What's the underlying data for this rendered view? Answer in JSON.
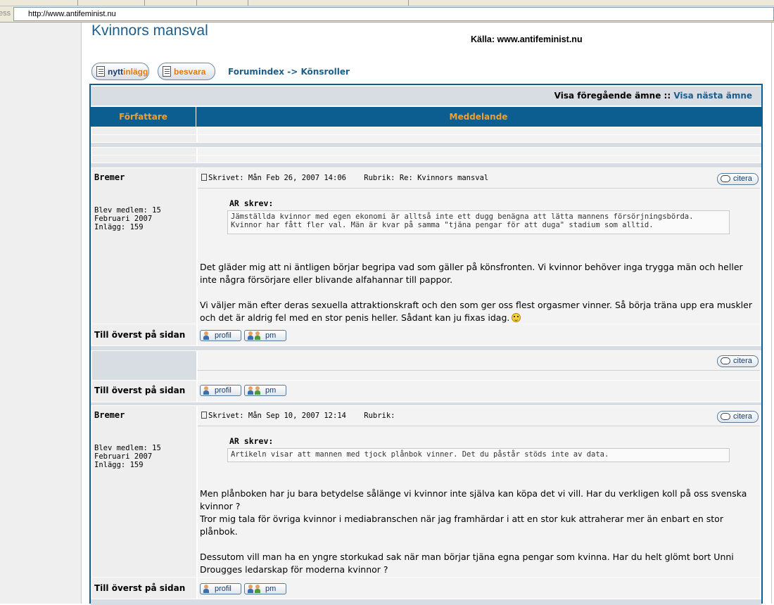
{
  "browser": {
    "address_label": "ess",
    "url": "http://www.antifeminist.nu"
  },
  "page": {
    "title": "Kvinnors mansval",
    "source": "Källa: www.antifeminist.nu"
  },
  "toolbar": {
    "new_post_a": "nytt",
    "new_post_b": "inlägg",
    "reply": "besvara"
  },
  "breadcrumb": {
    "index": "Forumindex",
    "sep": " -> ",
    "category": "Könsroller"
  },
  "nav": {
    "prev": "Visa föregående ämne",
    "sep": " :: ",
    "next": "Visa nästa ämne"
  },
  "table": {
    "col_author": "Författare",
    "col_message": "Meddelande"
  },
  "labels": {
    "cite": "citera",
    "to_top": "Till överst på sidan",
    "profile": "profil",
    "pm": "pm"
  },
  "posts": [
    {
      "author": "Bremer",
      "member_since": "Blev medlem: 15",
      "member_month": "Februari 2007",
      "post_count": "Inlägg: 159",
      "header": "Skrivet: Mån Feb 26, 2007 14:06    Rubrik: Re: Kvinnors mansval",
      "quote_who": "AR skrev:",
      "quote": "Jämställda kvinnor med egen ekonomi är alltså inte ett dugg benägna att lätta mannens försörjningsbörda. Kvinnor har fått fler val. Män är kvar på samma \"tjäna pengar för att duga\" stadium som alltid.",
      "p1": "Det gläder mig att ni äntligen börjar begripa vad som gäller på könsfronten. Vi kvinnor behöver inga trygga män och heller inte några försörjare eller blivande alfahannar till pappor.",
      "p2": "Vi väljer män efter deras sexuella attraktionskraft och den som ger oss flest orgasmer vinner. Så börja träna upp era muskler och det är aldrig fel med en stor penis heller. Sådant kan ju fixas idag."
    },
    {
      "author": "Bremer",
      "member_since": "Blev medlem: 15",
      "member_month": "Februari 2007",
      "post_count": "Inlägg: 159",
      "header": "Skrivet: Mån Sep 10, 2007 12:14    Rubrik:",
      "quote_who": "AR skrev:",
      "quote": "Artikeln visar att mannen med tjock plånbok vinner. Det du påstår stöds inte av data.",
      "p1": "Men plånboken har ju bara betydelse sålänge vi kvinnor inte själva kan köpa det vi vill. Har du verkligen koll på oss svenska kvinnor ?",
      "p1b": "Tror mig tala för övriga kvinnor i mediabranschen när jag framhärdar i att en stor kuk attraherar mer än enbart en stor plånbok.",
      "p2": "Dessutom vill man ha en yngre storkukad sak när man börjar tjäna egna pengar som kvinna. Har du helt glömt bort Unni Drougges ledarskap för moderna kvinnor ?"
    }
  ]
}
